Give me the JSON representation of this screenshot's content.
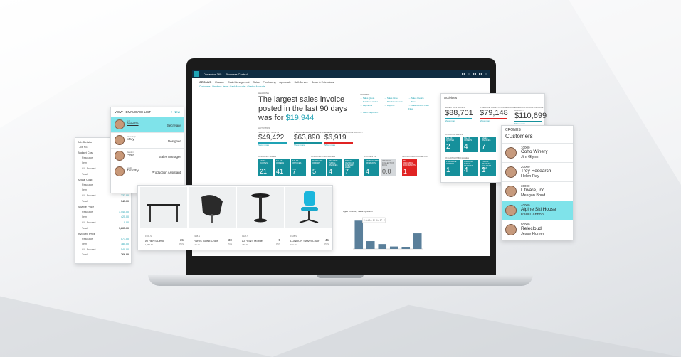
{
  "bc": {
    "brand": "Dynamics 365",
    "product": "Business Central",
    "company": "CRONUS",
    "menu": [
      "Finance",
      "Cash Management",
      "Sales",
      "Purchasing",
      "Approvals",
      "Self-Service",
      "Setup & Extensions"
    ],
    "sub_links": "Customers · Vendors · Items · Bank Accounts · Chart of Accounts",
    "headline_label": "HEADLINE",
    "headline_text": "The largest sales invoice posted in the last 90 days was for ",
    "headline_value": "$19,944",
    "actions_title": "ACTIONS",
    "actions": [
      "Sales Quote",
      "Sales Order",
      "Sales Invoice",
      "Purchase Order",
      "Purchase Invoice",
      "New",
      "Payments",
      "Reports",
      "Statement of Cash Flow",
      "Cash Requirem."
    ],
    "activities_label": "ACTIVITIES",
    "kpis": [
      {
        "label": "SALES THIS MONTH",
        "value": "$49,422",
        "color": "#1fa3b5",
        "link": "Show more"
      },
      {
        "label": "OVERDUE SALES INVOICE AMOUNT",
        "value": "$63,890",
        "color": "#16909b",
        "link": "Show more"
      },
      {
        "label": "OVERDUE PURCH. INVOICE AMOUNT",
        "value": "$6,919",
        "color": "#e02323",
        "link": "Show more"
      }
    ],
    "tile_groups": [
      "ONGOING SALES",
      "ONGOING PURCHASES",
      "PAYMENTS",
      "INCOMING DOCUMENTS"
    ],
    "tiles": [
      {
        "label": "SALES QUOTES",
        "value": "21",
        "kind": "teal"
      },
      {
        "label": "SALES ORDERS",
        "value": "41",
        "kind": "teal"
      },
      {
        "label": "SALES INVOICES",
        "value": "7",
        "kind": "teal"
      },
      {
        "label": "PURCHASE ORDERS",
        "value": "5",
        "kind": "teal"
      },
      {
        "label": "ONGOING PURCH. INVOICES",
        "value": "4",
        "kind": "teal"
      },
      {
        "label": "PURCH. INVOICES DUE NEXT WEEK",
        "value": "7",
        "kind": "teal"
      },
      {
        "label": "UNPROCESSED PAYMENTS",
        "value": "4",
        "kind": "teal"
      },
      {
        "label": "AVERAGE COLLECTION DAYS",
        "value": "0.0",
        "kind": "gray"
      },
      {
        "label": "MY INCOMING DOCUMENTS",
        "value": "1",
        "kind": "red"
      }
    ],
    "chart_title": "Aged Inventory Value by Month",
    "chart_tooltip": "Period Jan 16 - Jan 17 - 2"
  },
  "chart_data": {
    "type": "bar",
    "title": "Aged Inventory Value by Month",
    "categories": [
      "1",
      "2",
      "3",
      "4",
      "5",
      "6"
    ],
    "values": [
      58,
      16,
      10,
      5,
      4,
      32
    ],
    "ylim": [
      0,
      70
    ]
  },
  "activities": {
    "title": "Activities",
    "kpis": [
      {
        "label": "SALES THIS MONTH",
        "value": "$88,701",
        "color": "#1fa3b5",
        "link": "Show more"
      },
      {
        "label": "OVERDUE SALES INVOICE AMOUNT",
        "value": "$79,148",
        "color": "#e02323",
        "link": "Show more"
      },
      {
        "label": "OVERDUE PURCH. INVOICE AMOUNT",
        "value": "$110,699",
        "color": "#16909b",
        "link": "Show more"
      }
    ],
    "group1": "ONGOING SALES",
    "group2": "ONGOING PURCHASES",
    "tiles1": [
      {
        "label": "SALES QUOTES",
        "value": "2"
      },
      {
        "label": "SALES ORDERS",
        "value": "4"
      },
      {
        "label": "SALES INVOICES",
        "value": "7"
      }
    ],
    "tiles2": [
      {
        "label": "PURCHASE ORDERS",
        "value": "1"
      },
      {
        "label": "ONGOING PURCH. INVOICES",
        "value": "4"
      },
      {
        "label": "PURCH. INVOICES DUE NEXT WEEK",
        "value": "1"
      }
    ]
  },
  "customers": {
    "company": "CRONUS",
    "title": "Customers",
    "rows": [
      {
        "no": "10000",
        "name": "Coho Winery",
        "contact": "Jim Glynn",
        "selected": false
      },
      {
        "no": "20000",
        "name": "Trey Research",
        "contact": "Helen Ray",
        "selected": false
      },
      {
        "no": "30000",
        "name": "Litware, Inc.",
        "contact": "Meagan Bond",
        "selected": false
      },
      {
        "no": "40000",
        "name": "Alpine Ski House",
        "contact": "Paul Cannon",
        "selected": true
      },
      {
        "no": "50000",
        "name": "Relecloud",
        "contact": "Jesse Homer",
        "selected": false
      }
    ]
  },
  "employees": {
    "title": "VIEW - EMPLOYEE LIST",
    "new_label": "+ New",
    "rows": [
      {
        "tag": "Job",
        "first": "Annette",
        "role": "Secretary",
        "selected": true
      },
      {
        "tag": "Trimmings",
        "first": "Mary",
        "role": "Designer",
        "selected": false
      },
      {
        "tag": "Baddam",
        "first": "Peter",
        "role": "Sales Manager",
        "selected": false
      },
      {
        "tag": "Smith",
        "first": "Timothy",
        "role": "Production Assistant",
        "selected": false
      }
    ]
  },
  "job": {
    "rows": [
      {
        "label": "Job Details",
        "value": "",
        "kind": "h"
      },
      {
        "label": "Job No.",
        "value": "",
        "kind": "n"
      },
      {
        "label": "Budget Cost",
        "value": "",
        "kind": "h"
      },
      {
        "label": "Resource",
        "value": "",
        "kind": "i"
      },
      {
        "label": "Item",
        "value": "",
        "kind": "i"
      },
      {
        "label": "G/L Account",
        "value": "",
        "kind": "i"
      },
      {
        "label": "Total",
        "value": "",
        "kind": "i"
      },
      {
        "label": "Actual Cost",
        "value": "",
        "kind": "h"
      },
      {
        "label": "Resource",
        "value": "",
        "kind": "i"
      },
      {
        "label": "Item",
        "value": "",
        "kind": "i"
      },
      {
        "label": "G/L Account",
        "value": "233.00",
        "kind": "i"
      },
      {
        "label": "Total",
        "value": "745.00",
        "kind": "t"
      },
      {
        "label": "Billable Price",
        "value": "",
        "kind": "h"
      },
      {
        "label": "Resource",
        "value": "1,440.00",
        "kind": "i"
      },
      {
        "label": "Item",
        "value": "425.00",
        "kind": "i"
      },
      {
        "label": "G/L Account",
        "value": "0.00",
        "kind": "i"
      },
      {
        "label": "Total",
        "value": "1,865.00",
        "kind": "t"
      },
      {
        "label": "Invoiced Price",
        "value": "",
        "kind": "h"
      },
      {
        "label": "Resource",
        "value": "571.00",
        "kind": "i"
      },
      {
        "label": "Item",
        "value": "185.00",
        "kind": "i"
      },
      {
        "label": "G/L Account",
        "value": "540.00",
        "kind": "i"
      },
      {
        "label": "Total",
        "value": "766.00",
        "kind": "t"
      }
    ]
  },
  "items": [
    {
      "no": "1906-S",
      "name": "ATHENS Desk",
      "price": "35",
      "uom": "PCS",
      "sub": "1,360.40"
    },
    {
      "no": "1908-S",
      "name": "PARIS Guest Chair",
      "price": "30",
      "uom": "PCS",
      "sub": "125.10"
    },
    {
      "no": "1920-S",
      "name": "ATHENS Mobile",
      "price": "5",
      "uom": "PCS",
      "sub": "281.40"
    },
    {
      "no": "1928-S",
      "name": "LONDON Swivel Chair",
      "price": "45",
      "uom": "PCS",
      "sub": "190.10"
    }
  ]
}
